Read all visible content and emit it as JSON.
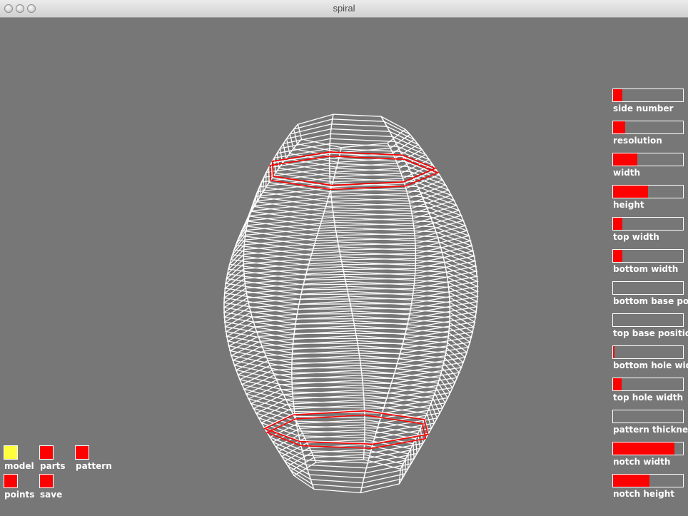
{
  "window": {
    "title": "spiral"
  },
  "sliders": [
    {
      "label": "side number",
      "value": 0.13
    },
    {
      "label": "resolution",
      "value": 0.17
    },
    {
      "label": "width",
      "value": 0.35
    },
    {
      "label": "height",
      "value": 0.5
    },
    {
      "label": "top width",
      "value": 0.13
    },
    {
      "label": "bottom width",
      "value": 0.13
    },
    {
      "label": "bottom base position",
      "value": 0.0
    },
    {
      "label": "top base position",
      "value": 0.0
    },
    {
      "label": "bottom hole width",
      "value": 0.02
    },
    {
      "label": "top hole width",
      "value": 0.12
    },
    {
      "label": "pattern thickness",
      "value": 0.0
    },
    {
      "label": "notch width",
      "value": 0.88
    },
    {
      "label": "notch height",
      "value": 0.52
    }
  ],
  "toggles": [
    {
      "label": "model",
      "color": "#ffff3c"
    },
    {
      "label": "parts",
      "color": "#ff0000"
    },
    {
      "label": "pattern",
      "color": "#ff0000"
    },
    {
      "label": "points",
      "color": "#ff0000"
    },
    {
      "label": "save",
      "color": "#ff0000"
    }
  ],
  "colors": {
    "background": "#777777",
    "accent": "#ff0000",
    "active": "#ffff3c",
    "wire": "#ffffff"
  }
}
